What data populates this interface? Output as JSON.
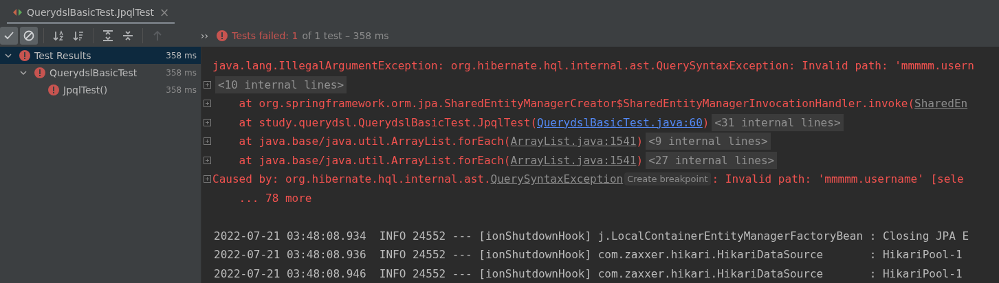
{
  "tab": {
    "title": "QuerydslBasicTest.JpqlTest",
    "close": "×",
    "selected": true
  },
  "toolbar": [
    {
      "kind": "show-passed",
      "on": true,
      "disabled": false
    },
    {
      "kind": "show-ignored",
      "on": true,
      "disabled": false
    },
    {
      "kind": "sort-alpha",
      "on": false,
      "disabled": false
    },
    {
      "kind": "sort-duration",
      "on": false,
      "disabled": false
    },
    {
      "kind": "expand-all",
      "on": false,
      "disabled": false
    },
    {
      "kind": "collapse-all",
      "on": false,
      "disabled": false
    },
    {
      "kind": "previous",
      "on": false,
      "disabled": true
    }
  ],
  "more": "››",
  "status": {
    "failed": "Tests failed: 1",
    "rest": "of 1 test – 358 ms"
  },
  "tree": [
    {
      "label": "Test Results",
      "time": "358 ms",
      "selected": true,
      "expanded": true,
      "failed": true,
      "children": [
        {
          "label": "QuerydslBasicTest",
          "time": "358 ms",
          "selected": false,
          "expanded": true,
          "failed": true,
          "children": [
            {
              "label": "JpqlTest()",
              "time": "358 ms",
              "selected": false,
              "failed": true
            }
          ]
        }
      ]
    }
  ],
  "console": [
    {
      "foldable": false,
      "parts": [
        {
          "kind": "error",
          "text": "java.lang.IllegalArgumentException: org.hibernate.hql.internal.ast.QuerySyntaxException: Invalid path: 'mmmmm.usern"
        }
      ]
    },
    {
      "foldable": true,
      "parts": [
        {
          "kind": "fold",
          "text": "<10 internal lines>"
        }
      ]
    },
    {
      "foldable": true,
      "parts": [
        {
          "kind": "error",
          "text": "    at org.springframework.orm.jpa.SharedEntityManagerCreator$SharedEntityManagerInvocationHandler.invoke("
        },
        {
          "kind": "source",
          "text": "SharedEn"
        }
      ]
    },
    {
      "foldable": true,
      "parts": [
        {
          "kind": "error",
          "text": "    at study.querydsl.QuerydslBasicTest.JpqlTest("
        },
        {
          "kind": "link",
          "text": "QuerydslBasicTest.java:60"
        },
        {
          "kind": "error",
          "text": ")"
        },
        {
          "kind": "fold",
          "text": "<31 internal lines>"
        }
      ]
    },
    {
      "foldable": true,
      "parts": [
        {
          "kind": "error",
          "text": "    at java.base/java.util.ArrayList.forEach("
        },
        {
          "kind": "source",
          "text": "ArrayList.java:1541"
        },
        {
          "kind": "error",
          "text": ")"
        },
        {
          "kind": "fold",
          "text": "<9 internal lines>"
        }
      ]
    },
    {
      "foldable": true,
      "parts": [
        {
          "kind": "error",
          "text": "    at java.base/java.util.ArrayList.forEach("
        },
        {
          "kind": "source",
          "text": "ArrayList.java:1541"
        },
        {
          "kind": "error",
          "text": ")"
        },
        {
          "kind": "fold",
          "text": "<27 internal lines>"
        }
      ]
    },
    {
      "foldable": true,
      "parts": [
        {
          "kind": "error",
          "text": "Caused by: org.hibernate.hql.internal.ast."
        },
        {
          "kind": "source",
          "text": "QuerySyntaxException"
        },
        {
          "kind": "hint",
          "text": "Create breakpoint"
        },
        {
          "kind": "error",
          "text": ": Invalid path: 'mmmmm.username' [sele"
        }
      ]
    },
    {
      "foldable": false,
      "parts": [
        {
          "kind": "error",
          "text": "    ... 78 more"
        }
      ]
    },
    {
      "foldable": false
    },
    {
      "foldable": false,
      "parts": [
        {
          "kind": "log",
          "text": "2022-07-21 03:48:08.934  INFO 24552 --- [ionShutdownHook] j.LocalContainerEntityManagerFactoryBean : Closing JPA E"
        }
      ]
    },
    {
      "foldable": false,
      "parts": [
        {
          "kind": "log",
          "text": "2022-07-21 03:48:08.936  INFO 24552 --- [ionShutdownHook] com.zaxxer.hikari.HikariDataSource       : HikariPool-1"
        }
      ]
    },
    {
      "foldable": false,
      "parts": [
        {
          "kind": "log",
          "text": "2022-07-21 03:48:08.946  INFO 24552 --- [ionShutdownHook] com.zaxxer.hikari.HikariDataSource       : HikariPool-1"
        }
      ]
    }
  ]
}
